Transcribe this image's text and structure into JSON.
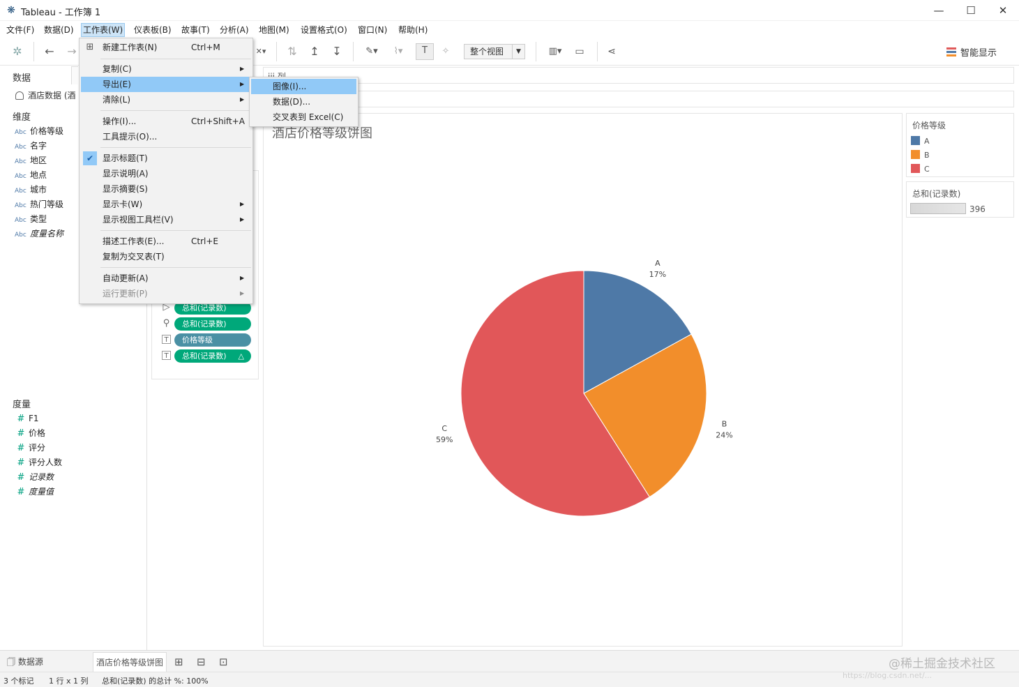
{
  "window": {
    "title": "Tableau - 工作簿 1",
    "minimize": "—",
    "maximize": "☐",
    "close": "✕"
  },
  "menubar": [
    "文件(F)",
    "数据(D)",
    "工作表(W)",
    "仪表板(B)",
    "故事(T)",
    "分析(A)",
    "地图(M)",
    "设置格式(O)",
    "窗口(N)",
    "帮助(H)"
  ],
  "toolbar": {
    "fit_select": "整个视图",
    "show_me": "智能显示"
  },
  "datapane": {
    "tab": "数据",
    "datasource": "酒店数据 (酒",
    "dimensions_title": "维度",
    "dimensions": [
      "价格等级",
      "名字",
      "地区",
      "地点",
      "城市",
      "热门等级",
      "类型",
      "度量名称"
    ],
    "measures_title": "度量",
    "measures": [
      "F1",
      "价格",
      "评分",
      "评分人数",
      "记录数",
      "度量值"
    ],
    "abc": "Abc",
    "hash": "#"
  },
  "marks": {
    "pills": [
      {
        "label": "总和(记录数)",
        "type": "green",
        "icon": "▷"
      },
      {
        "label": "总和(记录数)",
        "type": "green",
        "icon": "⚲"
      },
      {
        "label": "价格等级",
        "type": "blue",
        "icon": "T"
      },
      {
        "label": "总和(记录数)",
        "type": "green",
        "icon": "T",
        "delta": "△"
      }
    ]
  },
  "shelves": {
    "columns_label": "iii 列",
    "rows_label": ""
  },
  "view": {
    "title": "酒店价格等级饼图"
  },
  "legend_color": {
    "title": "价格等级",
    "items": [
      {
        "label": "A",
        "color": "#4e79a7"
      },
      {
        "label": "B",
        "color": "#f28e2b"
      },
      {
        "label": "C",
        "color": "#e15759"
      }
    ]
  },
  "legend_size": {
    "title": "总和(记录数)",
    "value": "396"
  },
  "chart_data": {
    "type": "pie",
    "title": "酒店价格等级饼图",
    "slices": [
      {
        "category": "A",
        "percent": 17,
        "label": "17%",
        "color": "#4e79a7"
      },
      {
        "category": "B",
        "percent": 24,
        "label": "24%",
        "color": "#f28e2b"
      },
      {
        "category": "C",
        "percent": 59,
        "label": "59%",
        "color": "#e15759"
      }
    ]
  },
  "menu": {
    "items": [
      {
        "label": "新建工作表(N)",
        "shortcut": "Ctrl+M",
        "icon": "⊞"
      },
      {
        "label": "复制(C)",
        "submenu": "▶"
      },
      {
        "label": "导出(E)",
        "submenu": "▶"
      },
      {
        "label": "清除(L)",
        "submenu": "▶"
      },
      {
        "label": "操作(I)...",
        "shortcut": "Ctrl+Shift+A"
      },
      {
        "label": "工具提示(O)..."
      },
      {
        "label": "显示标题(T)",
        "check": "✔"
      },
      {
        "label": "显示说明(A)"
      },
      {
        "label": "显示摘要(S)"
      },
      {
        "label": "显示卡(W)",
        "submenu": "▶"
      },
      {
        "label": "显示视图工具栏(V)",
        "submenu": "▶"
      },
      {
        "label": "描述工作表(E)...",
        "shortcut": "Ctrl+E"
      },
      {
        "label": "复制为交叉表(T)"
      },
      {
        "label": "自动更新(A)",
        "submenu": "▶"
      },
      {
        "label": "运行更新(P)",
        "submenu": "▶"
      }
    ]
  },
  "submenu": {
    "items": [
      "图像(I)...",
      "数据(D)...",
      "交叉表到 Excel(C)"
    ]
  },
  "tabs": {
    "datasource": "数据源",
    "sheet": "酒店价格等级饼图"
  },
  "status": {
    "marks": "3 个标记",
    "rows_cols": "1 行 x 1 列",
    "summary": "总和(记录数) 的总计 %: 100%"
  },
  "watermark": "@稀土掘金技术社区",
  "watermark_url": "https://blog.csdn.net/..."
}
